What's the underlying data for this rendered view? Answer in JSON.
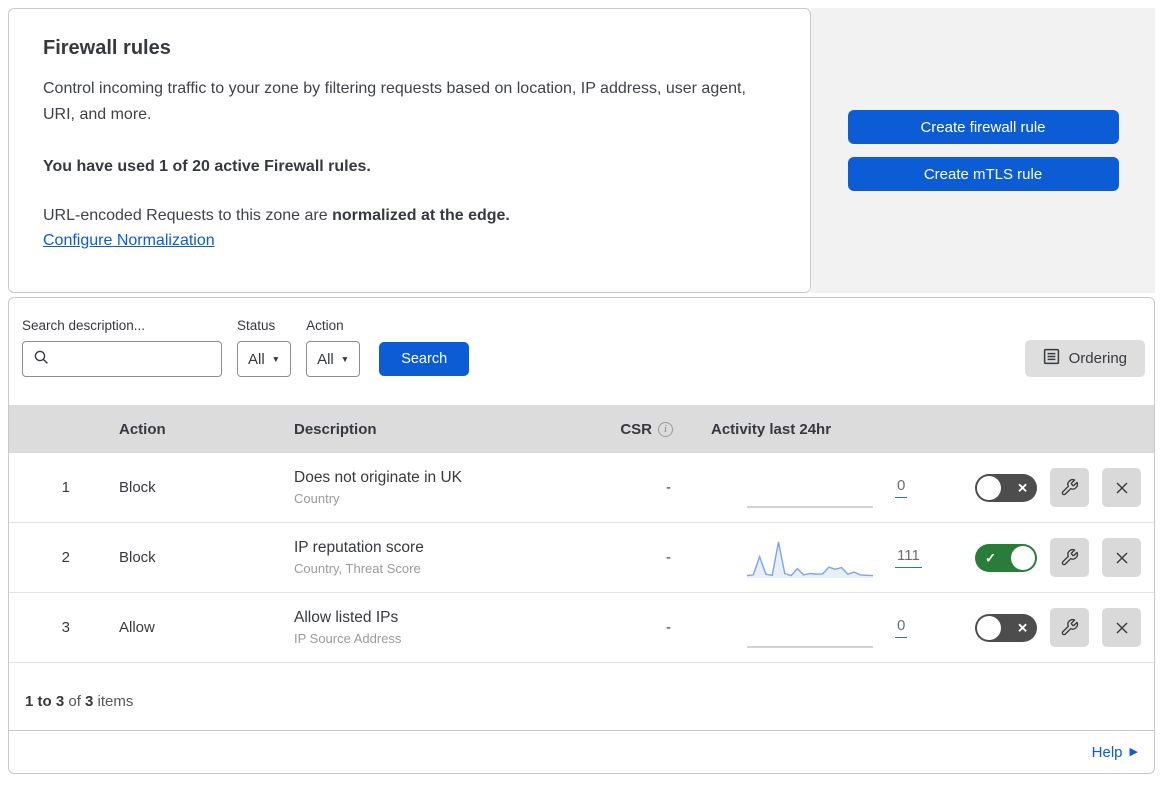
{
  "colors": {
    "button_blue": "#0b5cd5",
    "link_blue": "#0b5cd5",
    "toggle_on_green": "#2a7d39",
    "toggle_off_gray": "#4d4d4d",
    "sparkline_blue": "#7aa5e8"
  },
  "intro": {
    "title": "Firewall rules",
    "description": "Control incoming traffic to your zone by filtering requests based on location, IP address, user agent, URI, and more.",
    "usage_bold": "You have used 1 of 20 active Firewall rules.",
    "normalization_prefix": "URL-encoded Requests to this zone are ",
    "normalization_bold": "normalized at the edge.",
    "normalization_link": "Configure Normalization"
  },
  "actions_panel": {
    "create_firewall_rule_label": "Create firewall rule",
    "create_mtls_rule_label": "Create mTLS rule"
  },
  "filters": {
    "search_label": "Search description...",
    "search_value": "",
    "status_label": "Status",
    "status_value": "All",
    "action_label": "Action",
    "action_value": "All",
    "search_button_label": "Search",
    "ordering_button_label": "Ordering"
  },
  "table": {
    "headers": {
      "action": "Action",
      "description": "Description",
      "csr": "CSR",
      "info_glyph": "i",
      "activity": "Activity last 24hr"
    },
    "rows": [
      {
        "num": "1",
        "action": "Block",
        "title": "Does not originate in UK",
        "subtitle": "Country",
        "csr": "-",
        "count": "0",
        "enabled": false,
        "sparkline": []
      },
      {
        "num": "2",
        "action": "Block",
        "title": "IP reputation score",
        "subtitle": "Country, Threat Score",
        "csr": "-",
        "count": "111",
        "enabled": true,
        "sparkline": [
          4,
          6,
          58,
          8,
          5,
          100,
          10,
          4,
          24,
          6,
          10,
          8,
          9,
          28,
          22,
          27,
          8,
          14,
          6,
          5,
          4
        ]
      },
      {
        "num": "3",
        "action": "Allow",
        "title": "Allow listed IPs",
        "subtitle": "IP Source Address",
        "csr": "-",
        "count": "0",
        "enabled": false,
        "sparkline": []
      }
    ]
  },
  "footer": {
    "range_bold": "1 to 3",
    "of_text": " of ",
    "total_bold": "3",
    "items_text": " items"
  },
  "help": {
    "label": "Help"
  },
  "toggle_glyphs": {
    "on_check": "✓",
    "off_x": "✕"
  }
}
